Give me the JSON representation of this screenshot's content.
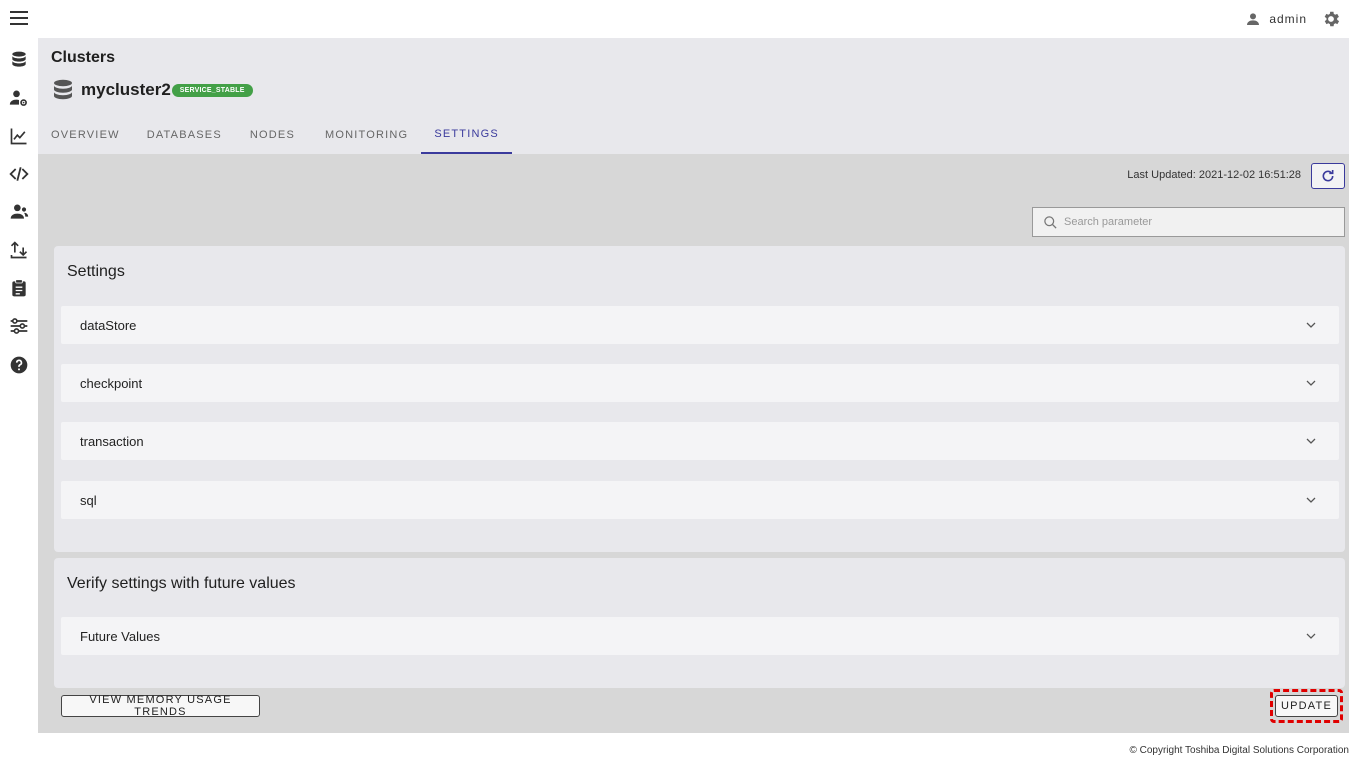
{
  "topbar": {
    "user_name": "admin"
  },
  "sidebar": {
    "items": [
      {
        "name": "clusters",
        "icon": "database-icon"
      },
      {
        "name": "user-settings",
        "icon": "user-gear-icon"
      },
      {
        "name": "monitoring",
        "icon": "chart-line-icon"
      },
      {
        "name": "query",
        "icon": "code-icon"
      },
      {
        "name": "users",
        "icon": "users-icon"
      },
      {
        "name": "import-export",
        "icon": "upload-download-icon"
      },
      {
        "name": "logs",
        "icon": "clipboard-icon"
      },
      {
        "name": "settings",
        "icon": "sliders-icon"
      },
      {
        "name": "help",
        "icon": "help-icon"
      }
    ]
  },
  "header": {
    "breadcrumb": "Clusters",
    "cluster_name": "mycluster2",
    "status": "SERVICE_STABLE",
    "status_color": "#43a047",
    "tabs": [
      {
        "label": "OVERVIEW",
        "active": false
      },
      {
        "label": "DATABASES",
        "active": false
      },
      {
        "label": "NODES",
        "active": false
      },
      {
        "label": "MONITORING",
        "active": false
      },
      {
        "label": "SETTINGS",
        "active": true
      }
    ]
  },
  "main": {
    "last_updated": "Last Updated: 2021-12-02 16:51:28",
    "search_placeholder": "Search parameter",
    "settings_card": {
      "title": "Settings",
      "sections": [
        "dataStore",
        "checkpoint",
        "transaction",
        "sql"
      ]
    },
    "verify_card": {
      "title": "Verify settings with future values",
      "sections": [
        "Future Values"
      ]
    },
    "memory_button": "VIEW MEMORY USAGE TRENDS",
    "update_button": "UPDATE"
  },
  "footer": {
    "copyright": "© Copyright Toshiba Digital Solutions Corporation"
  },
  "colors": {
    "accent": "#3a3a9c",
    "highlight": "#e00000"
  }
}
